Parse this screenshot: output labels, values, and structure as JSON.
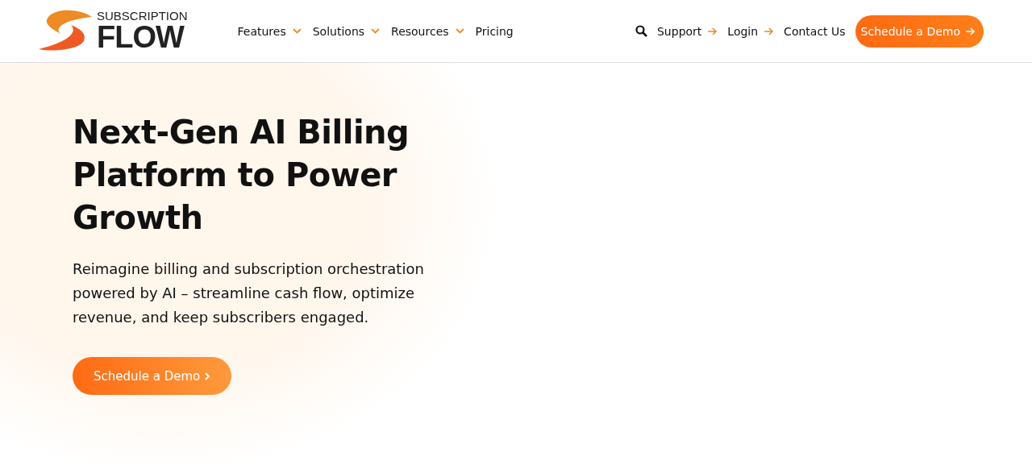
{
  "logo": {
    "top": "SUBSCRIPTION",
    "bottom": "FLOW"
  },
  "nav": [
    {
      "label": "Features",
      "kind": "dropdown"
    },
    {
      "label": "Solutions",
      "kind": "dropdown"
    },
    {
      "label": "Resources",
      "kind": "dropdown"
    },
    {
      "label": "Pricing",
      "kind": "plain"
    }
  ],
  "utility": [
    {
      "label": "Support",
      "kind": "arrow"
    },
    {
      "label": "Login",
      "kind": "arrow"
    },
    {
      "label": "Contact Us",
      "kind": "plain"
    }
  ],
  "header_button": "Schedule a Demo",
  "hero": {
    "title": "Next-Gen AI Billing Platform to Power Growth",
    "text": "Reimagine billing and subscription orchestration powered by AI – streamline cash flow, optimize revenue, and keep subscribers engaged.",
    "button": "Schedule a Demo"
  }
}
